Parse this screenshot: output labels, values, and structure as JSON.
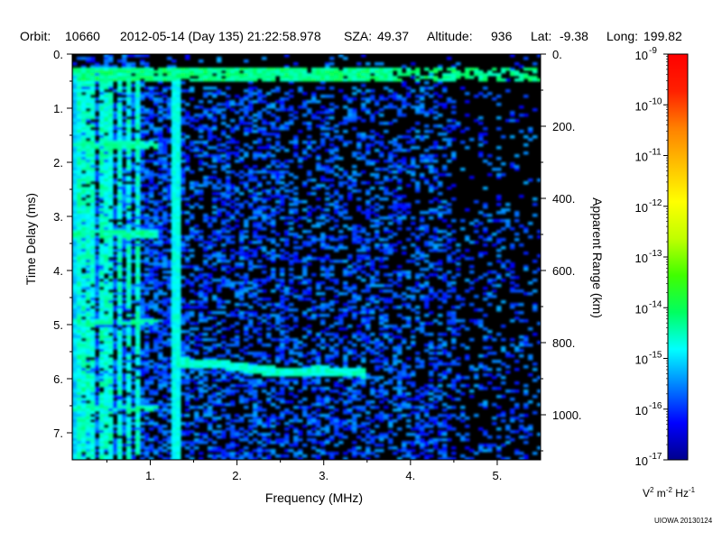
{
  "header": {
    "orbit_label": "Orbit:",
    "orbit_value": "10660",
    "datetime": "2012-05-14 (Day 135) 21:22:58.978",
    "sza_label": "SZA:",
    "sza_value": "49.37",
    "altitude_label": "Altitude:",
    "altitude_value": "936",
    "lat_label": "Lat:",
    "lat_value": "-9.38",
    "long_label": "Long:",
    "long_value": "199.82"
  },
  "chart_data": {
    "type": "heatmap",
    "xlabel": "Frequency (MHz)",
    "ylabel": "Time Delay (ms)",
    "y2label": "Apparent Range (km)",
    "xlim": [
      0.1,
      5.5
    ],
    "ylim": [
      7.5,
      0
    ],
    "y2lim": [
      0,
      1125
    ],
    "xticks": [
      "1.",
      "2.",
      "3.",
      "4.",
      "5."
    ],
    "xtick_values": [
      1,
      2,
      3,
      4,
      5
    ],
    "yticks": [
      "0.",
      "1.",
      "2.",
      "3.",
      "4.",
      "5.",
      "6.",
      "7."
    ],
    "ytick_values": [
      0,
      1,
      2,
      3,
      4,
      5,
      6,
      7
    ],
    "y2ticks": [
      "0.",
      "200.",
      "400.",
      "600.",
      "800.",
      "1000."
    ],
    "y2tick_values": [
      0,
      200,
      400,
      600,
      800,
      1000
    ],
    "colorbar": {
      "scale": "log",
      "range": [
        1e-17,
        1e-09
      ],
      "tick_bases": [
        "10",
        "10",
        "10",
        "10",
        "10",
        "10",
        "10",
        "10",
        "10"
      ],
      "tick_exponents": [
        "-9",
        "-10",
        "-11",
        "-12",
        "-13",
        "-14",
        "-15",
        "-16",
        "-17"
      ],
      "tick_values": [
        -9,
        -10,
        -11,
        -12,
        -13,
        -14,
        -15,
        -16,
        -17
      ],
      "unit_parts": [
        "V",
        "2",
        " m",
        "-2",
        " Hz",
        "-1"
      ],
      "colors": [
        "#00008c",
        "#0000ff",
        "#0080ff",
        "#00ffff",
        "#00ff60",
        "#40ff00",
        "#c0ff00",
        "#ffff00",
        "#ffc000",
        "#ff8000",
        "#ff2000",
        "#ff0000"
      ]
    },
    "features": [
      {
        "name": "ground-echo-band",
        "x_range": [
          0.1,
          5.5
        ],
        "y_range": [
          0.25,
          0.5
        ],
        "level": -14.3
      },
      {
        "name": "cutoff-line",
        "x": 1.3,
        "y_range": [
          0.3,
          7.5
        ],
        "level": -14.8
      },
      {
        "name": "plasma-harmonic-lines",
        "x": [
          0.2,
          0.3,
          0.45,
          0.55,
          0.65,
          0.75,
          0.85
        ],
        "y_range": [
          0.3,
          7.5
        ],
        "level": -14.5
      },
      {
        "name": "echo-trace",
        "x": [
          1.3,
          1.8,
          2.3,
          2.6,
          3.0,
          3.5
        ],
        "y": [
          5.7,
          5.73,
          5.85,
          5.87,
          5.85,
          5.9
        ],
        "level": -14.6
      },
      {
        "name": "resonance-rows",
        "y": [
          1.68,
          3.32,
          4.95,
          6.55
        ],
        "x_range": [
          0.1,
          1.1
        ],
        "level": -14.5
      }
    ]
  },
  "footer": {
    "credit": "UIOWA 20130124"
  }
}
